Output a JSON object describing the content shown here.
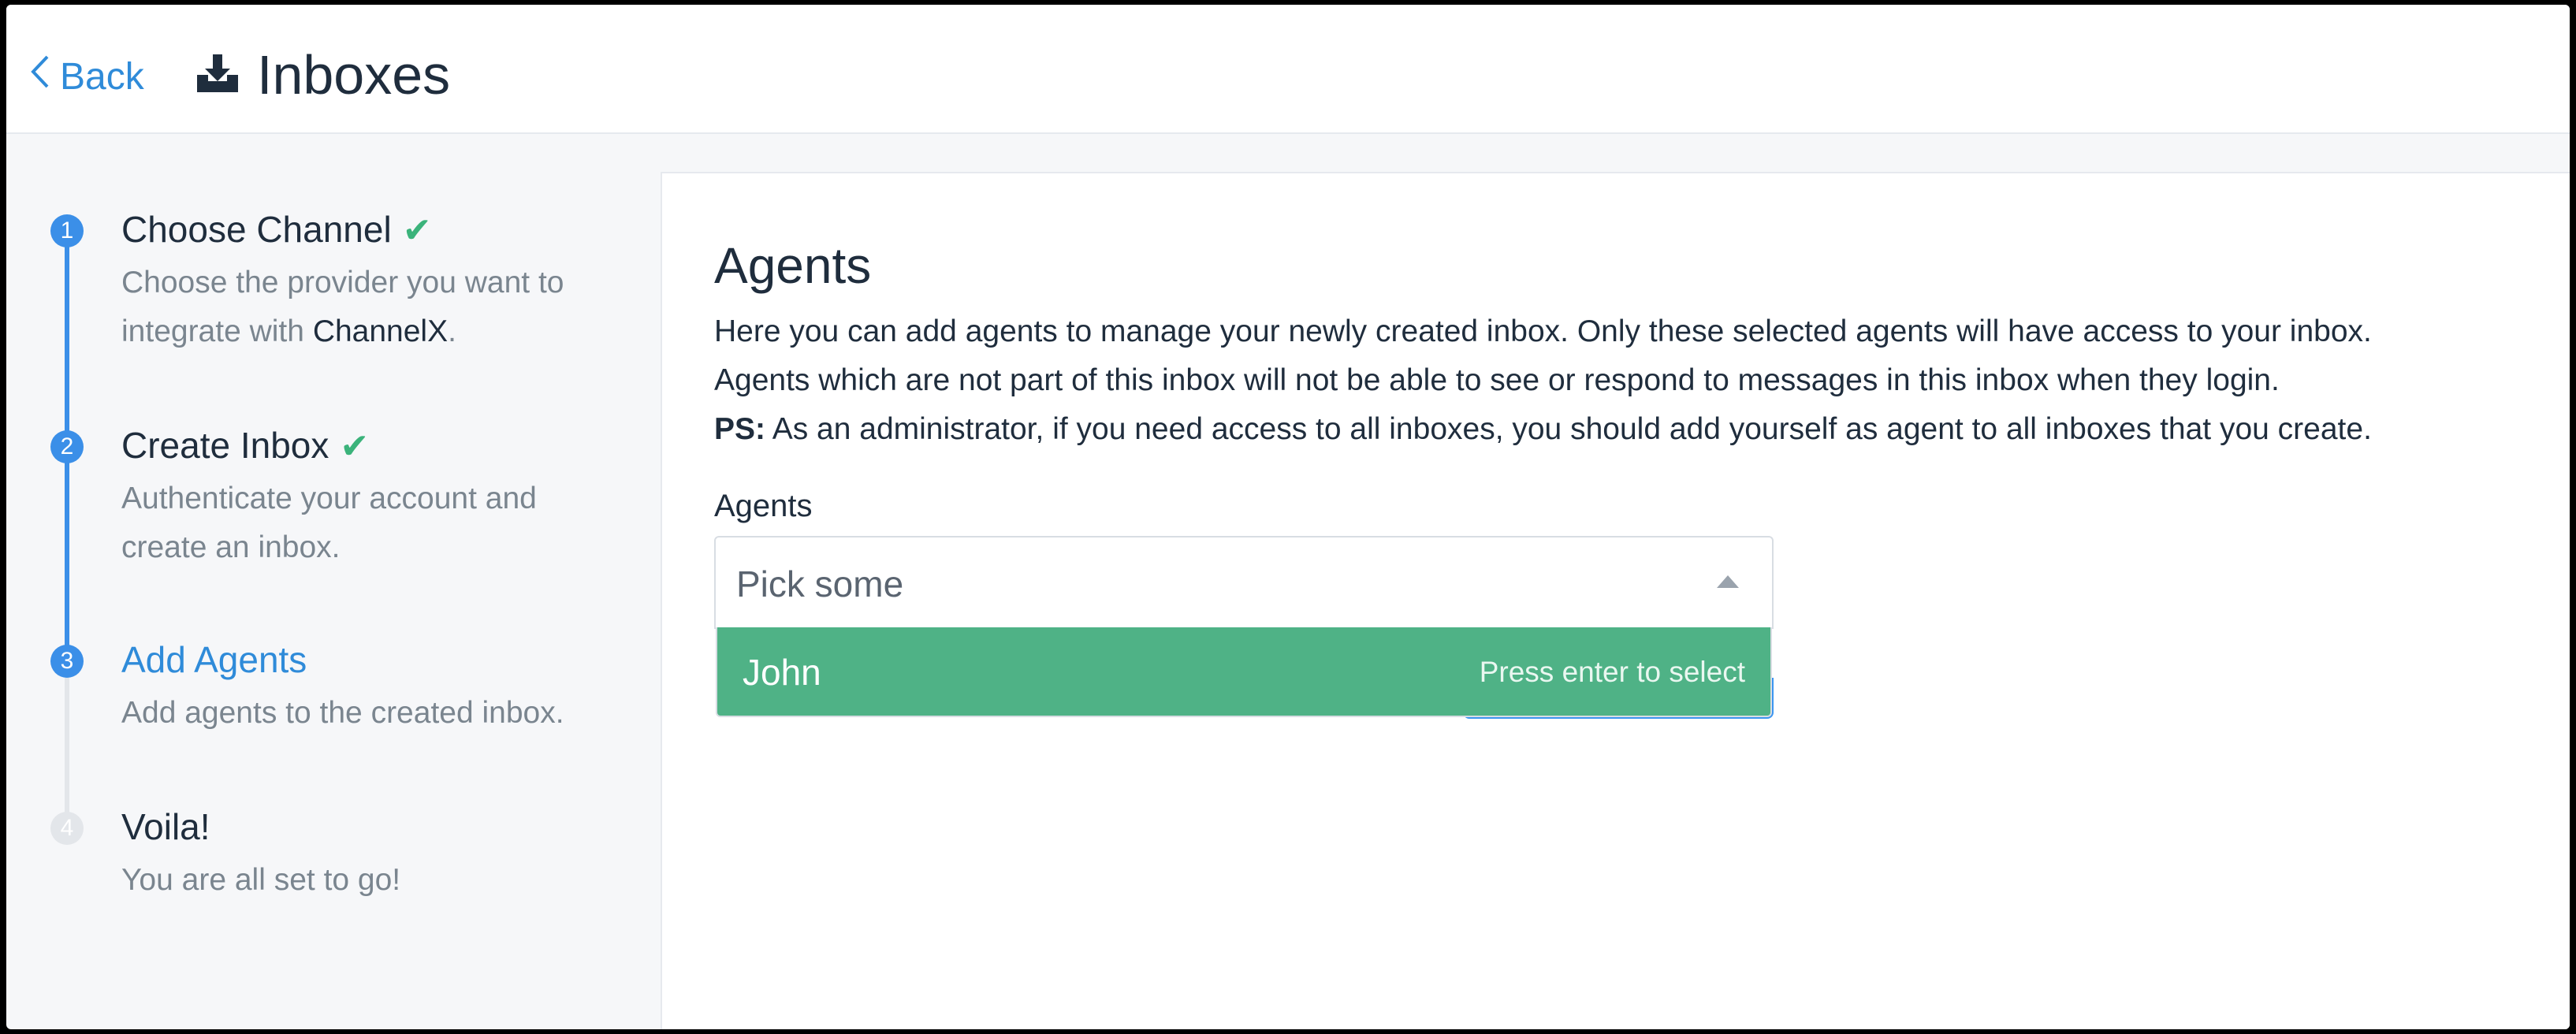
{
  "header": {
    "back_label": "Back",
    "title": "Inboxes",
    "icons": {
      "back": "chevron-left-icon",
      "title": "inbox-download-icon"
    }
  },
  "colors": {
    "accent": "#2f8bd9",
    "step_active": "#3b8fe8",
    "step_inactive": "#e3e6ea",
    "success": "#3bb37b",
    "option_highlight": "#4fb286",
    "primary_button": "#3b95f0"
  },
  "wizard": {
    "steps": [
      {
        "number": "1",
        "title": "Choose Channel",
        "desc_before": "Choose the provider you want to integrate with ",
        "desc_highlight": "ChannelX",
        "desc_after": ".",
        "completed": true
      },
      {
        "number": "2",
        "title": "Create Inbox",
        "desc": "Authenticate your account and create an inbox.",
        "completed": true
      },
      {
        "number": "3",
        "title": "Add Agents",
        "desc": "Add agents to the created inbox.",
        "active": true
      },
      {
        "number": "4",
        "title": "Voila!",
        "desc": "You are all set to go!"
      }
    ]
  },
  "main": {
    "title": "Agents",
    "description_line1": "Here you can add agents to manage your newly created inbox. Only these selected agents will have access to your inbox.",
    "description_line2": "Agents which are not part of this inbox will not be able to see or respond to messages in this inbox when they login.",
    "description_ps_label": "PS:",
    "description_ps": " As an administrator, if you need access to all inboxes, you should add yourself as agent to all inboxes that you create.",
    "agents_field": {
      "label": "Agents",
      "placeholder": "Pick some",
      "options": [
        {
          "label": "John",
          "hint": "Press enter to select"
        }
      ]
    }
  }
}
